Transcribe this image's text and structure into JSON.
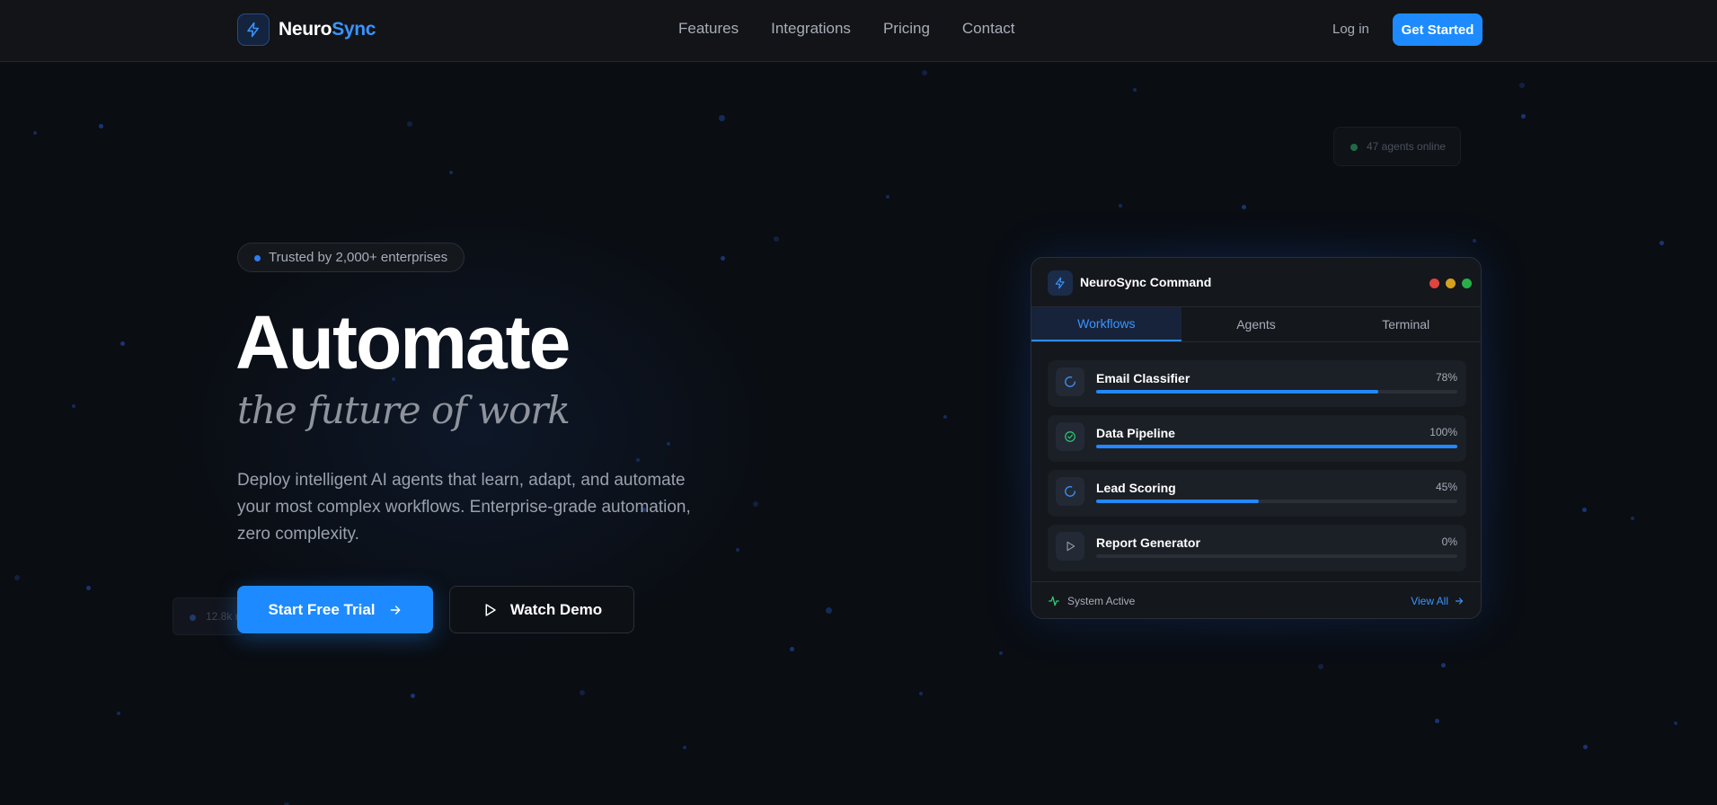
{
  "brand": {
    "name_part1": "Neuro",
    "name_part2": "Sync",
    "accent": "#1d8bff",
    "logo_icon": "bolt-icon"
  },
  "nav": {
    "items": [
      "Features",
      "Integrations",
      "Pricing",
      "Contact"
    ],
    "login": "Log in",
    "cta": "Get Started"
  },
  "hero": {
    "badge": "Trusted by 2,000+ enterprises",
    "title": "Automate",
    "subtitle": "the future of work",
    "description": "Deploy intelligent AI agents that learn, adapt, and automate your most complex workflows. Enterprise-grade automation, zero complexity.",
    "primary_button": "Start Free Trial",
    "secondary_button": "Watch Demo"
  },
  "floating": {
    "agents_online": "47 agents online",
    "ghost_stat": "12.8k r"
  },
  "panel": {
    "title": "NeuroSync Command",
    "traffic_lights": [
      "#e0443e",
      "#d6a11d",
      "#27b04a"
    ],
    "tabs": [
      "Workflows",
      "Agents",
      "Terminal"
    ],
    "active_tab": "Workflows",
    "workflows": [
      {
        "name": "Email Classifier",
        "percent": 78,
        "percent_label": "78%",
        "icon": "loading-icon"
      },
      {
        "name": "Data Pipeline",
        "percent": 100,
        "percent_label": "100%",
        "icon": "check-circle-icon"
      },
      {
        "name": "Lead Scoring",
        "percent": 45,
        "percent_label": "45%",
        "icon": "loading-icon"
      },
      {
        "name": "Report Generator",
        "percent": 0,
        "percent_label": "0%",
        "icon": "play-icon"
      }
    ],
    "status": "System Active",
    "view_all": "View All"
  }
}
